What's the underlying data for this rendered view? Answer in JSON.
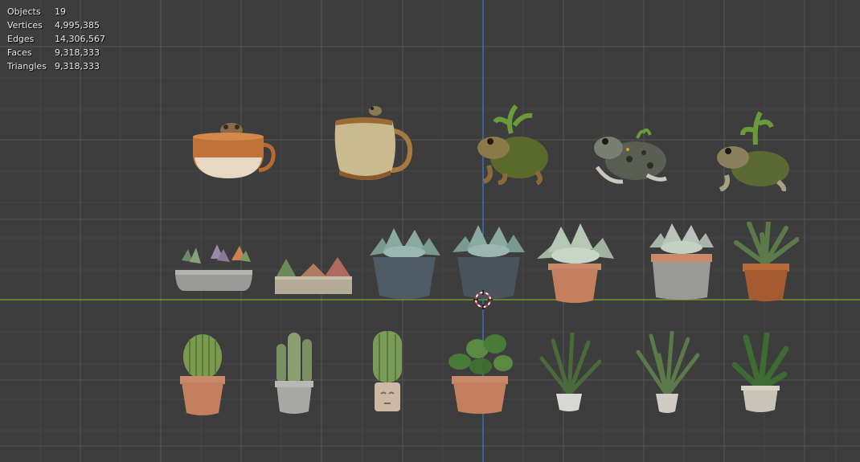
{
  "statistics": [
    {
      "label": "Objects",
      "value": "19"
    },
    {
      "label": "Vertices",
      "value": "4,995,385"
    },
    {
      "label": "Edges",
      "value": "14,306,567"
    },
    {
      "label": "Faces",
      "value": "9,318,333"
    },
    {
      "label": "Triangles",
      "value": "9,318,333"
    }
  ],
  "colors": {
    "background": "#3d3d3d",
    "grid_major": "#555555",
    "grid_minor": "#494949",
    "x_axis": "#6f9a2e",
    "y_axis": "#3e74b8",
    "stat_text": "#e6e6e6",
    "cursor_red": "#e0393d"
  },
  "scene_objects": [
    "frog-in-teacup",
    "ceramic-mug-with-frog",
    "toad-with-plant",
    "spotted-toad",
    "toad-with-sprout",
    "succulent-trough-planter",
    "rectangular-succulent-planter",
    "echeveria-blue-pot",
    "echeveria-dark-pot",
    "echeveria-terracotta-pot",
    "echeveria-grey-pot",
    "aloe-terracotta-pot",
    "barrel-cactus-terracotta",
    "columnar-cactus-concrete",
    "cactus-face-pot",
    "pothos-terracotta-pot",
    "dracaena-white-pot",
    "palm-small-white-pot",
    "snake-plant-concrete-pot"
  ]
}
